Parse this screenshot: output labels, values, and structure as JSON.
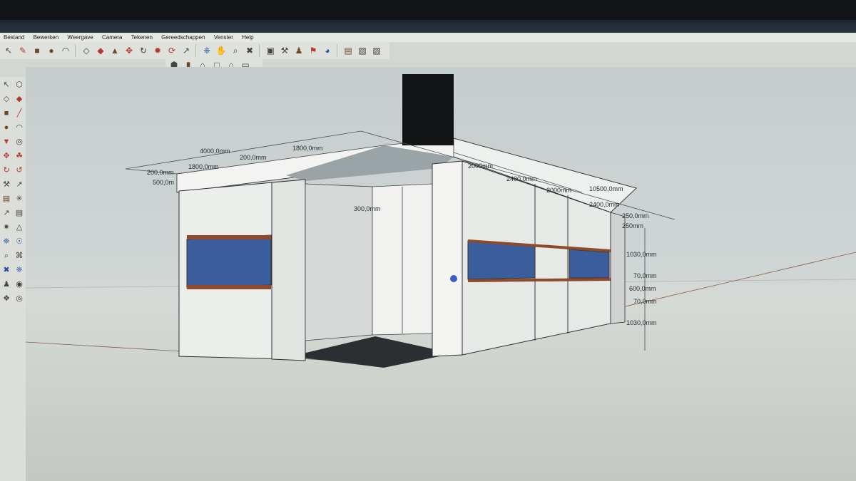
{
  "window": {
    "title": ""
  },
  "menu": {
    "items": [
      "Bestand",
      "Bewerken",
      "Weergave",
      "Camera",
      "Tekenen",
      "Gereedschappen",
      "Venster",
      "Help"
    ]
  },
  "toolbar_icons": [
    "select-icon",
    "pencil-icon",
    "rectangle-icon",
    "circle-icon",
    "arc-icon",
    "eraser-icon",
    "paint-bucket-icon",
    "pushpull-icon",
    "move-icon",
    "rotate-icon",
    "follow-me-icon",
    "orbit-icon",
    "pan-icon",
    "zoom-icon",
    "zoom-extents-icon",
    "tape-icon",
    "components-icon",
    "warehouse-icon",
    "share-icon",
    "extension-icon",
    "layers-icon"
  ],
  "view_icons": [
    "iso-view-icon",
    "front-view-icon",
    "top-view-icon",
    "right-view-icon",
    "back-view-icon",
    "left-view-icon"
  ],
  "dimensions": {
    "d1": "4000,0mm",
    "d2": "1800,0mm",
    "d3": "200,0mm",
    "d4": "1800,0mm",
    "d5": "200,0mm",
    "d6": "500,0m",
    "d7": "2000mm",
    "d8": "2400,0mm",
    "d9": "10500,0mm",
    "d10": "2400,0mm",
    "d11": "2000mm",
    "d12": "250mm",
    "d13": "1030,0mm",
    "d14": "70,0mm",
    "d15": "600,0mm",
    "d16": "70,0mm",
    "d17": "1030,0mm",
    "d18": "250,0mm",
    "d19": "300,0mm"
  }
}
